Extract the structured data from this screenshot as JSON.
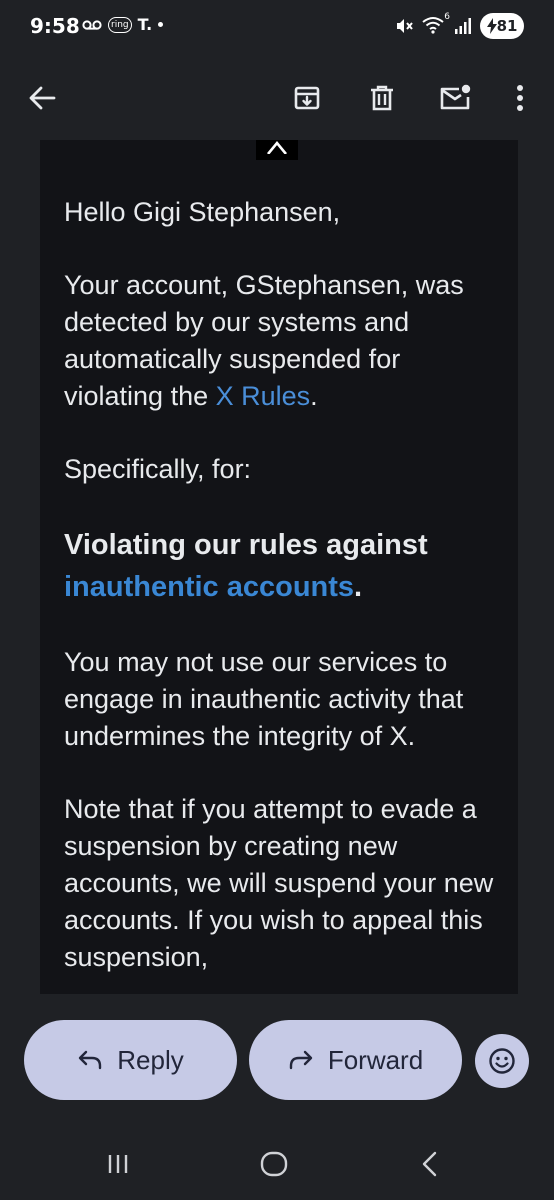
{
  "status_bar": {
    "time": "9:58",
    "ring_label": "ring",
    "t_label": "T.",
    "signal_label": "6",
    "battery": "81"
  },
  "app_bar": {
    "icons": [
      "back-arrow-icon",
      "archive-icon",
      "delete-icon",
      "mark-unread-icon",
      "more-vert-icon"
    ]
  },
  "email": {
    "greeting": "Hello Gigi Stephansen,",
    "para1_pre": "Your account, GStephansen, was detected by our systems and automatically suspended for violating the ",
    "para1_link": "X Rules",
    "para1_post": ".",
    "para2": "Specifically, for:",
    "bold_pre": "Violating our rules against ",
    "bold_link": "inauthentic accounts",
    "bold_post": ".",
    "para3": "You may not use our services to engage in inauthentic activity that undermines the integrity of X.",
    "para4": "Note that if you attempt to evade a suspension by creating new accounts, we will suspend your new accounts. If you wish to appeal this suspension,"
  },
  "actions": {
    "reply_label": "Reply",
    "forward_label": "Forward"
  },
  "colors": {
    "background": "#1f2125",
    "email_background": "#121317",
    "link": "#4a8ed8",
    "pill": "#c6cae6"
  }
}
